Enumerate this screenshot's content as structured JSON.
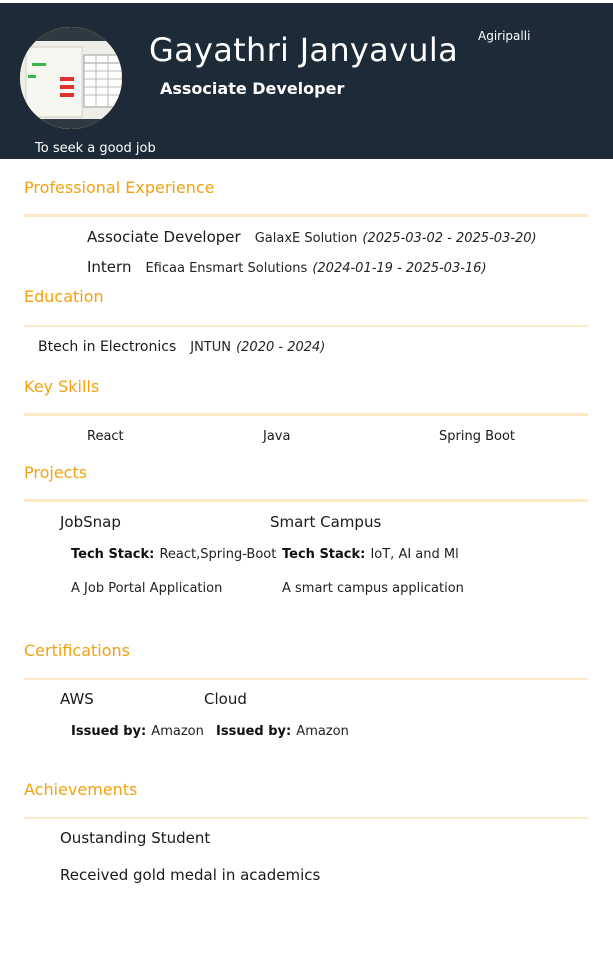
{
  "header": {
    "name": "Gayathri Janyavula",
    "role": "Associate Developer",
    "location": "Agiripalli",
    "objective": "To seek a good job",
    "background_color": "#1d2b38"
  },
  "accent_color": "#f2a20f",
  "experience": {
    "title": "Professional Experience",
    "items": [
      {
        "position": "Associate Developer",
        "company": "GalaxE Solution",
        "dates": "(2025-03-02 - 2025-03-20)"
      },
      {
        "position": "Intern",
        "company": "Eficaa Ensmart Solutions",
        "dates": "(2024-01-19 - 2025-03-16)"
      }
    ]
  },
  "education": {
    "title": "Education",
    "items": [
      {
        "degree": "Btech in Electronics",
        "school": "JNTUN",
        "dates": "(2020 - 2024)"
      }
    ]
  },
  "skills": {
    "title": "Key Skills",
    "items": [
      "React",
      "Java",
      "Spring Boot"
    ]
  },
  "projects": {
    "title": "Projects",
    "tech_label": "Tech Stack:",
    "items": [
      {
        "name": "JobSnap",
        "tech": "React,Spring-Boot",
        "description": "A Job Portal Application"
      },
      {
        "name": "Smart Campus",
        "tech": "IoT, AI and Ml",
        "description": "A smart campus application"
      }
    ]
  },
  "certifications": {
    "title": "Certifications",
    "issued_label": "Issued by:",
    "items": [
      {
        "name": "AWS",
        "issuer": "Amazon"
      },
      {
        "name": "Cloud",
        "issuer": "Amazon"
      }
    ]
  },
  "achievements": {
    "title": "Achievements",
    "items": [
      "Oustanding Student",
      "Received gold medal in academics"
    ]
  }
}
